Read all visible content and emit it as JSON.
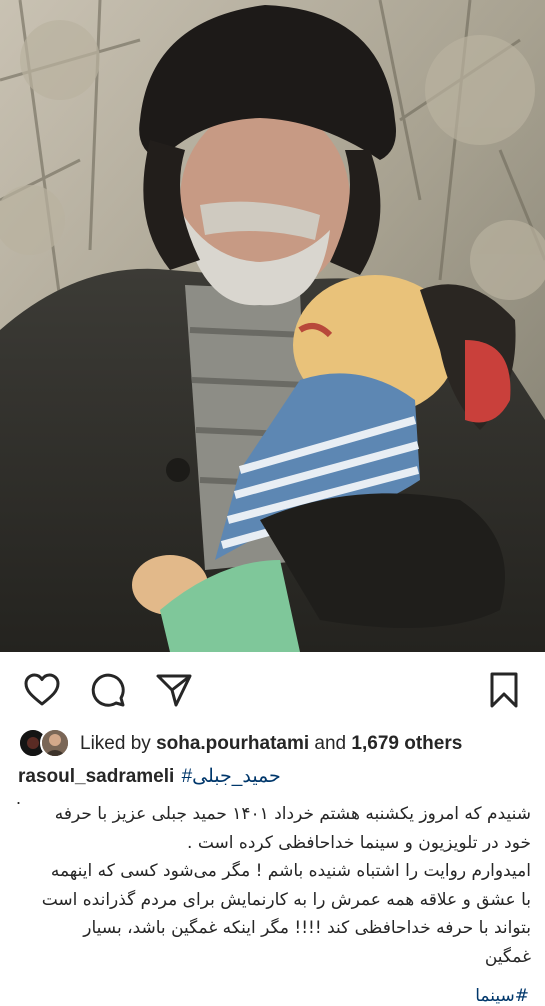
{
  "post": {
    "image_description": "Photo of a bearded man in a fur hat hugging a puppet",
    "actions": {
      "like_icon": "heart-outline-icon",
      "comment_icon": "comment-bubble-icon",
      "share_icon": "paper-plane-icon",
      "save_icon": "bookmark-outline-icon"
    },
    "likes": {
      "prefix": "Liked by",
      "user": "soha.pourhatami",
      "middle": "and",
      "count": "1,679 others"
    },
    "author": {
      "username": "rasoul_sadrameli",
      "hashtag": "#حمید_جبلی"
    },
    "caption": {
      "dot": ".",
      "lines": [
        "شنیدم که امروز یکشنبه هشتم خرداد ۱۴۰۱ حمید جبلی عزیز با حرفه",
        "خود در تلویزیون و سینما خداحافظی کرده است .",
        "امیدوارم روایت را اشتباه شنیده باشم ! مگر می‌شود کسی که اینهمه",
        "با عشق و علاقه همه عمرش را به کارنمایش برای مردم گذرانده است",
        "بتواند با حرفه خداحافظی کند !!!! مگر اینکه غمگین باشد، بسیار",
        "غمگین"
      ],
      "cut_tag": "#سینما"
    }
  }
}
